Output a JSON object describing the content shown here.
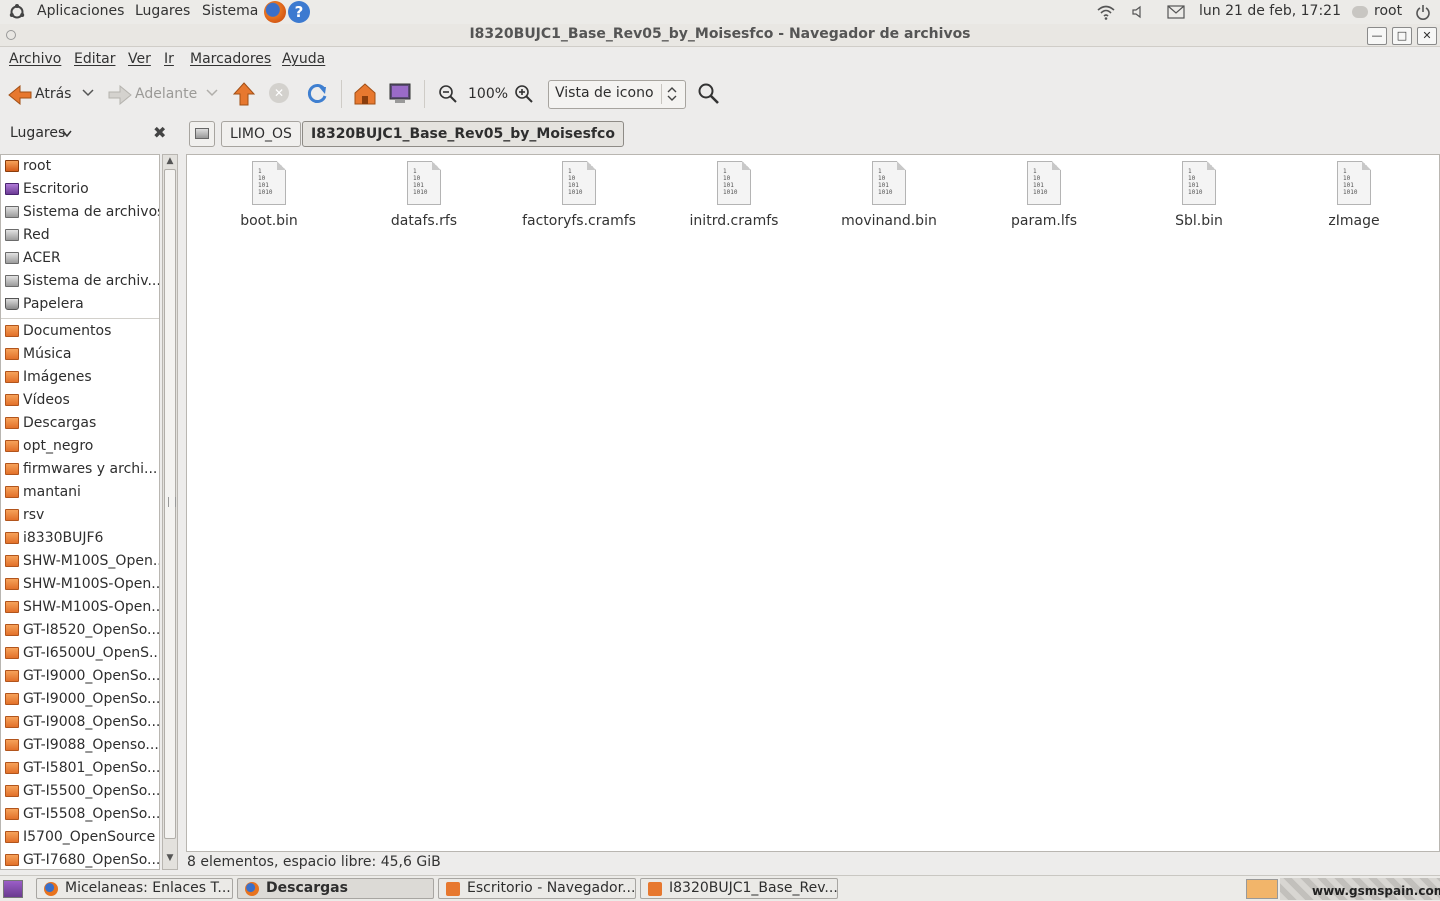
{
  "top_panel": {
    "menus": [
      "Aplicaciones",
      "Lugares",
      "Sistema"
    ],
    "clock": "lun 21 de feb, 17:21",
    "user": "root"
  },
  "window": {
    "title": "I8320BUJC1_Base_Rev05_by_Moisesfco - Navegador de archivos",
    "menu": [
      "Archivo",
      "Editar",
      "Ver",
      "Ir",
      "Marcadores",
      "Ayuda"
    ]
  },
  "toolbar": {
    "back_label": "Atrás",
    "forward_label": "Adelante",
    "zoom_level": "100%",
    "view_mode": "Vista de icono"
  },
  "side_pane": {
    "header": "Lugares",
    "items": [
      {
        "label": "root",
        "icon": "home-folder-icon"
      },
      {
        "label": "Escritorio",
        "icon": "desktop-icon"
      },
      {
        "label": "Sistema de archivos",
        "icon": "drive-icon"
      },
      {
        "label": "Red",
        "icon": "network-icon"
      },
      {
        "label": "ACER",
        "icon": "drive-icon"
      },
      {
        "label": "Sistema de archiv...",
        "icon": "drive-icon"
      },
      {
        "label": "Papelera",
        "icon": "trash-icon"
      },
      {
        "label": "Documentos",
        "icon": "folder-icon"
      },
      {
        "label": "Música",
        "icon": "music-folder-icon"
      },
      {
        "label": "Imágenes",
        "icon": "pictures-folder-icon"
      },
      {
        "label": "Vídeos",
        "icon": "videos-folder-icon"
      },
      {
        "label": "Descargas",
        "icon": "downloads-folder-icon"
      },
      {
        "label": "opt_negro",
        "icon": "folder-icon"
      },
      {
        "label": "firmwares y archi...",
        "icon": "folder-icon"
      },
      {
        "label": "mantani",
        "icon": "folder-icon"
      },
      {
        "label": "rsv",
        "icon": "folder-icon"
      },
      {
        "label": "i8330BUJF6",
        "icon": "folder-icon"
      },
      {
        "label": "SHW-M100S_Open...",
        "icon": "folder-icon"
      },
      {
        "label": "SHW-M100S-Open...",
        "icon": "folder-icon"
      },
      {
        "label": "SHW-M100S-Open...",
        "icon": "folder-icon"
      },
      {
        "label": "GT-I8520_OpenSo...",
        "icon": "folder-icon"
      },
      {
        "label": "GT-I6500U_OpenS...",
        "icon": "folder-icon"
      },
      {
        "label": "GT-I9000_OpenSo...",
        "icon": "folder-icon"
      },
      {
        "label": "GT-I9000_OpenSo...",
        "icon": "folder-icon"
      },
      {
        "label": "GT-I9008_OpenSo...",
        "icon": "folder-icon"
      },
      {
        "label": "GT-I9088_Openso...",
        "icon": "folder-icon"
      },
      {
        "label": "GT-I5801_OpenSo...",
        "icon": "folder-icon"
      },
      {
        "label": "GT-I5500_OpenSo...",
        "icon": "folder-icon"
      },
      {
        "label": "GT-I5508_OpenSo...",
        "icon": "folder-icon"
      },
      {
        "label": "I5700_OpenSource",
        "icon": "folder-icon"
      },
      {
        "label": "GT-I7680_OpenSo...",
        "icon": "folder-icon"
      }
    ]
  },
  "path_bar": {
    "crumbs": [
      "LIMO_OS",
      "I8320BUJC1_Base_Rev05_by_Moisesfco"
    ]
  },
  "files": [
    {
      "name": "boot.bin"
    },
    {
      "name": "datafs.rfs"
    },
    {
      "name": "factoryfs.cramfs"
    },
    {
      "name": "initrd.cramfs"
    },
    {
      "name": "movinand.bin"
    },
    {
      "name": "param.lfs"
    },
    {
      "name": "Sbl.bin"
    },
    {
      "name": "zImage"
    }
  ],
  "file_icon_bits": "1\n10\n101\n1010",
  "status": "8 elementos, espacio libre: 45,6 GiB",
  "taskbar": {
    "tasks": [
      {
        "label": "Micelaneas: Enlaces T...",
        "active": false
      },
      {
        "label": "Descargas",
        "active": true
      },
      {
        "label": "Escritorio - Navegador...",
        "active": false
      },
      {
        "label": "I8320BUJC1_Base_Rev...",
        "active": false
      }
    ],
    "watermark": "www.gsmspain.com"
  },
  "colors": {
    "folder": "#e8792f",
    "panel_bg": "#ecebe8",
    "window_bg": "#edeceb",
    "refresh_blue": "#3f7fd0",
    "home_orange": "#e7782f"
  }
}
